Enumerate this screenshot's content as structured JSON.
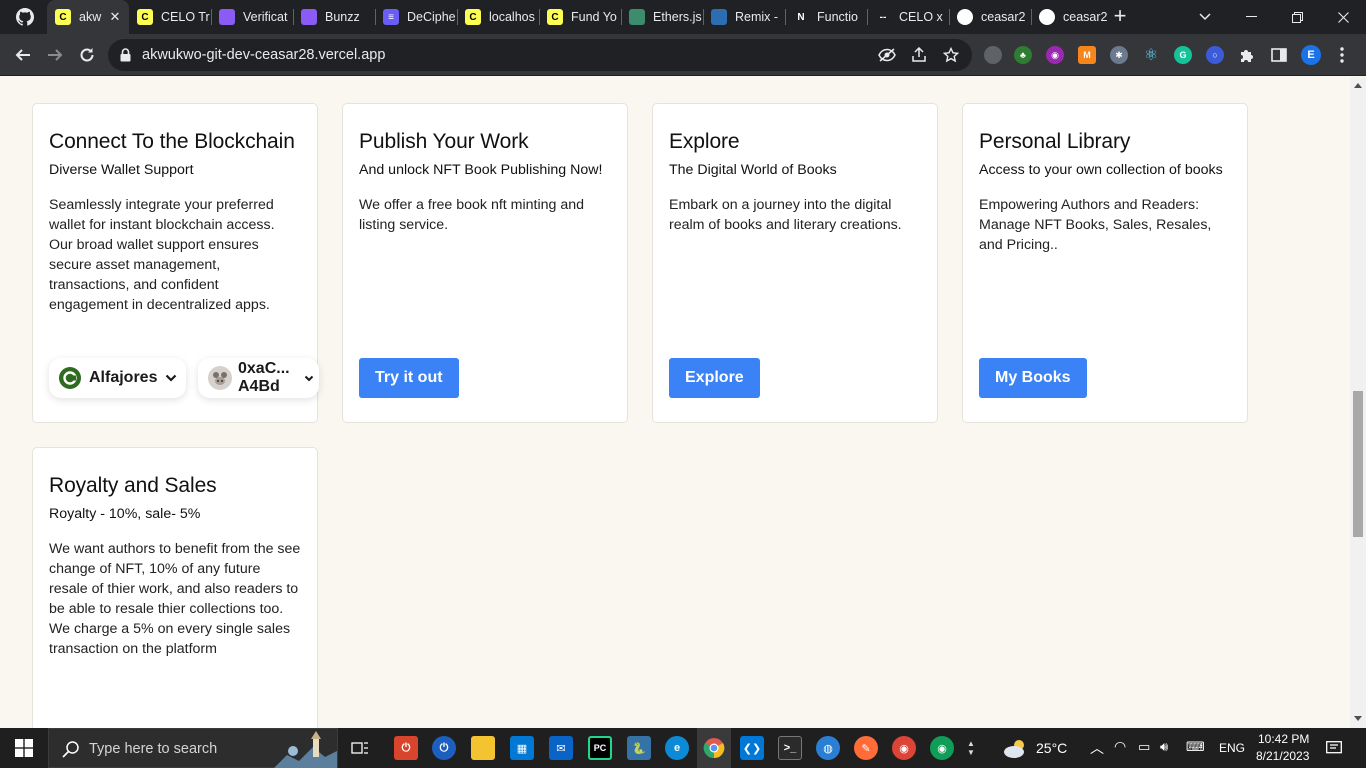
{
  "browser": {
    "tabs": [
      {
        "title": "akw",
        "active": true,
        "favicon_color": "#fcff52",
        "favicon_text": "C",
        "favicon_name": "celo-favicon-icon"
      },
      {
        "title": "CELO Tr",
        "favicon_color": "#fcff52",
        "favicon_text": "C",
        "favicon_name": "celo-favicon-icon"
      },
      {
        "title": "Verificat",
        "favicon_color": "#8a5cf5",
        "favicon_text": "",
        "favicon_name": "globe-favicon-icon"
      },
      {
        "title": "Bunzz",
        "favicon_color": "#8a5cf5",
        "favicon_text": "",
        "favicon_name": "globe-favicon-icon"
      },
      {
        "title": "DeCiphe",
        "favicon_color": "#6b5cf5",
        "favicon_text": "≡",
        "favicon_name": "decipher-favicon-icon"
      },
      {
        "title": "localhos",
        "favicon_color": "#fcff52",
        "favicon_text": "C",
        "favicon_name": "celo-favicon-icon"
      },
      {
        "title": "Fund Yo",
        "favicon_color": "#fcff52",
        "favicon_text": "C",
        "favicon_name": "celo-favicon-icon"
      },
      {
        "title": "Ethers.js",
        "favicon_color": "#3c8d6e",
        "favicon_text": "",
        "favicon_name": "ethers-favicon-icon"
      },
      {
        "title": "Remix -",
        "favicon_color": "#2b6fb2",
        "favicon_text": "",
        "favicon_name": "remix-favicon-icon"
      },
      {
        "title": "Functio",
        "favicon_color": "#202124",
        "favicon_text": "N",
        "favicon_name": "nextjs-favicon-icon"
      },
      {
        "title": "CELO x",
        "favicon_color": "#202124",
        "favicon_text": "--",
        "favicon_name": "dash-favicon-icon"
      },
      {
        "title": "ceasar2",
        "favicon_color": "#ffffff",
        "favicon_text": "",
        "favicon_name": "github-favicon-icon"
      },
      {
        "title": "ceasar2",
        "favicon_color": "#ffffff",
        "favicon_text": "",
        "favicon_name": "github-favicon-icon"
      }
    ],
    "url": "akwukwo-git-dev-ceasar28.vercel.app",
    "profile_initial": "E"
  },
  "cards": [
    {
      "title": "Connect To the Blockchain",
      "subtitle": "Diverse Wallet Support",
      "description": "Seamlessly integrate your preferred wallet for instant blockchain access. Our broad wallet support ensures secure asset management, transactions, and confident engagement in decentralized apps.",
      "network_label": "Alfajores",
      "account_line1": "0xaC...",
      "account_line2": "A4Bd"
    },
    {
      "title": "Publish Your Work",
      "subtitle": "And unlock NFT Book Publishing Now!",
      "description": "We offer a free book nft minting and listing service.",
      "button": "Try it out"
    },
    {
      "title": "Explore",
      "subtitle": "The Digital World of Books",
      "description": "Embark on a journey into the digital realm of books and literary creations.",
      "button": "Explore"
    },
    {
      "title": "Personal Library",
      "subtitle": "Access to your own collection of books",
      "description": "Empowering Authors and Readers: Manage NFT Books, Sales, Resales, and Pricing..",
      "button": "My Books"
    },
    {
      "title": "Royalty and Sales",
      "subtitle": "Royalty - 10%, sale- 5%",
      "description": "We want authors to benefit from the see change of NFT, 10% of any future resale of thier work, and also readers to be able to resale thier collections too. We charge a 5% on every single sales transaction on the platform"
    }
  ],
  "taskbar": {
    "search_placeholder": "Type here to search",
    "weather": "25°C",
    "language": "ENG",
    "time": "10:42 PM",
    "date": "8/21/2023"
  },
  "colors": {
    "accent": "#3b82f6",
    "page_bg": "#faf6f0",
    "celo_green": "#35d07f"
  }
}
